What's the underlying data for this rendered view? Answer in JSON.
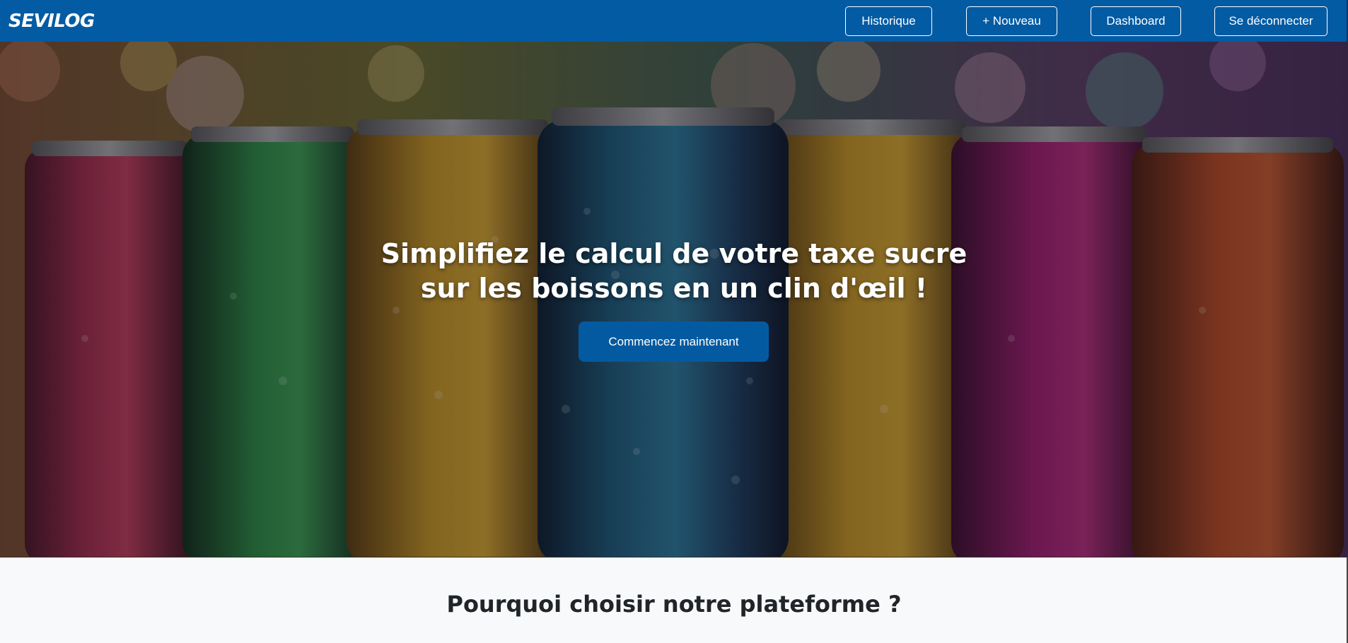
{
  "navbar": {
    "brand": "SEVILOG",
    "buttons": {
      "history": "Historique",
      "new": "+ Nouveau",
      "dashboard": "Dashboard",
      "logout": "Se déconnecter"
    },
    "bg_color": "#035ba3"
  },
  "hero": {
    "title_line1": "Simplifiez le calcul de votre taxe sucre",
    "title_line2": "sur les boissons en un clin d'œil !",
    "cta_label": "Commencez maintenant",
    "cta_color": "#045aa0",
    "image": "soda-cans-background"
  },
  "features": {
    "title": "Pourquoi choisir notre plateforme ?"
  }
}
